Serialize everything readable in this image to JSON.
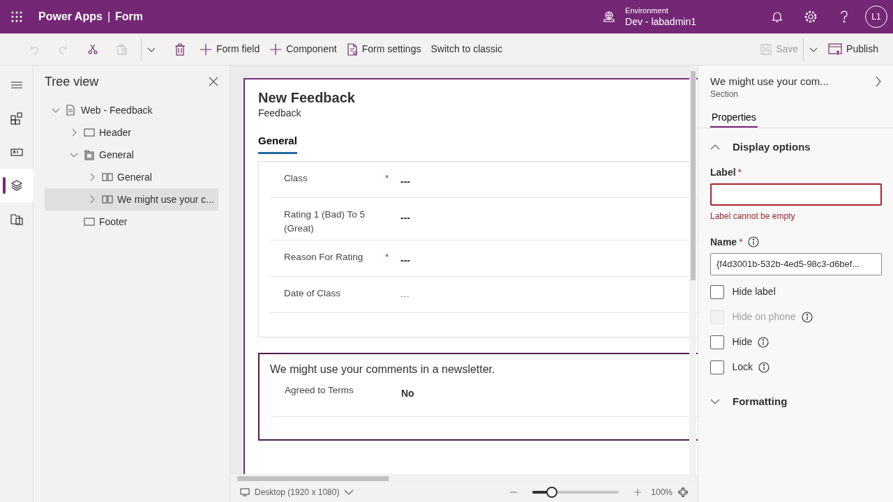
{
  "app_bar": {
    "product": "Power Apps",
    "separator": "|",
    "page": "Form",
    "environment_label": "Environment",
    "environment": "Dev - labadmin1",
    "avatar": "L1"
  },
  "toolbar": {
    "left": [
      {
        "kind": "undo",
        "disabled": true
      },
      {
        "kind": "redo",
        "disabled": true
      },
      {
        "kind": "cut",
        "disabled": false
      },
      {
        "kind": "paste",
        "disabled": true
      },
      {
        "kind": "more",
        "disabled": false
      },
      {
        "kind": "delete",
        "disabled": false
      },
      {
        "kind": "add",
        "label": "Form field",
        "disabled": false
      },
      {
        "kind": "add",
        "label": "Component",
        "disabled": false
      },
      {
        "kind": "settings",
        "label": "Form settings",
        "disabled": false
      },
      {
        "kind": "text",
        "label": "Switch to classic",
        "disabled": false
      }
    ],
    "right": [
      {
        "kind": "save",
        "label": "Save",
        "disabled": true
      },
      {
        "kind": "more",
        "disabled": false
      },
      {
        "kind": "publish",
        "label": "Publish",
        "disabled": false
      }
    ]
  },
  "rail": [
    {
      "kind": "menu",
      "selected": false
    },
    {
      "kind": "components",
      "selected": false
    },
    {
      "kind": "fields",
      "selected": false
    },
    {
      "kind": "tree",
      "selected": true
    },
    {
      "kind": "tables",
      "selected": false
    }
  ],
  "tree": {
    "title": "Tree view",
    "nodes": [
      {
        "label": "Web - Feedback",
        "kind": "document",
        "expanded": true,
        "selected": false,
        "children": [
          {
            "label": "Header",
            "kind": "header",
            "expanded": false,
            "selected": false
          },
          {
            "label": "General",
            "kind": "tab",
            "expanded": true,
            "selected": false,
            "children": [
              {
                "label": "General",
                "kind": "section",
                "expanded": false,
                "selected": false
              },
              {
                "label": "We might use your c...",
                "kind": "section",
                "expanded": false,
                "selected": true
              }
            ]
          },
          {
            "label": "Footer",
            "kind": "footer",
            "selected": false
          }
        ]
      }
    ]
  },
  "form": {
    "title": "New Feedback",
    "subtitle": "Feedback",
    "tabs": [
      {
        "label": "General",
        "selected": true
      }
    ],
    "sections": [
      {
        "selected": false,
        "fields": [
          {
            "label": "Class",
            "required_mark": "*",
            "value": "---",
            "kind": "text"
          },
          {
            "label": "Rating 1 (Bad) To 5 (Great)",
            "value": "---",
            "kind": "text"
          },
          {
            "label": "Reason For Rating",
            "required_mark": "*",
            "value": "---",
            "kind": "text"
          },
          {
            "label": "Date of Class",
            "value": "---",
            "kind": "date"
          }
        ]
      },
      {
        "selected": true,
        "title": "We might use your comments in a newsletter.",
        "fields": [
          {
            "label": "Agreed to Terms",
            "value": "No",
            "kind": "toggle"
          }
        ]
      }
    ]
  },
  "properties": {
    "title": "We might use your com...",
    "subtitle": "Section",
    "tabs": [
      {
        "label": "Properties",
        "selected": true
      }
    ],
    "display_options": {
      "title": "Display options",
      "expanded": true
    },
    "label_field": {
      "label": "Label",
      "required_mark": "*",
      "error": "Label cannot be empty"
    },
    "name_field": {
      "label": "Name",
      "required_mark": "*",
      "value": "{f4d3001b-532b-4ed5-98c3-d6bef..."
    },
    "checkboxes": [
      {
        "label": "Hide label",
        "checked": false,
        "disabled": false,
        "info": false
      },
      {
        "label": "Hide on phone",
        "checked": false,
        "disabled": true,
        "info": true
      },
      {
        "label": "Hide",
        "checked": false,
        "disabled": false,
        "info": true
      },
      {
        "label": "Lock",
        "checked": false,
        "disabled": false,
        "info": true
      }
    ],
    "formatting": {
      "title": "Formatting",
      "expanded": false
    }
  },
  "status_bar": {
    "device": "Desktop (1920 x 1080)",
    "zoom": "100%",
    "zoom_level": {
      "level": 0.22
    }
  }
}
